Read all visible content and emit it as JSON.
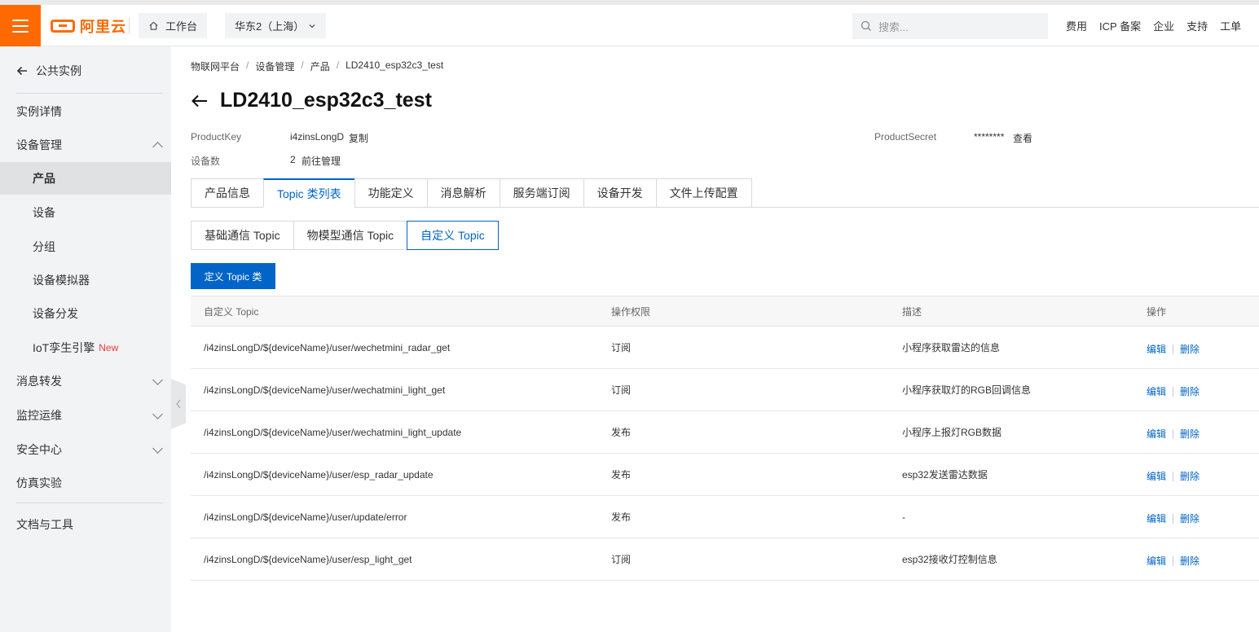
{
  "topbar": {
    "logo_text": "阿里云",
    "workbench": "工作台",
    "region": "华东2（上海）",
    "search_placeholder": "搜索...",
    "links": [
      "费用",
      "ICP 备案",
      "企业",
      "支持",
      "工单"
    ]
  },
  "sidebar": {
    "back": "公共实例",
    "items": {
      "instance_detail": "实例详情",
      "device_mgmt": "设备管理",
      "product": "产品",
      "device": "设备",
      "group": "分组",
      "simulator": "设备模拟器",
      "distribution": "设备分发",
      "twin": "IoT孪生引擎",
      "twin_tag": "New",
      "message": "消息转发",
      "monitor": "监控运维",
      "security": "安全中心",
      "simulation": "仿真实验",
      "docs": "文档与工具"
    }
  },
  "breadcrumb": [
    "物联网平台",
    "设备管理",
    "产品",
    "LD2410_esp32c3_test"
  ],
  "page": {
    "title": "LD2410_esp32c3_test",
    "product_key_label": "ProductKey",
    "product_key": "i4zinsLongD",
    "copy": "复制",
    "product_secret_label": "ProductSecret",
    "product_secret": "********",
    "view": "查看",
    "device_count_label": "设备数",
    "device_count": "2",
    "go_manage": "前往管理"
  },
  "tabs": [
    "产品信息",
    "Topic 类列表",
    "功能定义",
    "消息解析",
    "服务端订阅",
    "设备开发",
    "文件上传配置"
  ],
  "subtabs": [
    "基础通信 Topic",
    "物模型通信 Topic",
    "自定义 Topic"
  ],
  "define_button": "定义 Topic 类",
  "table": {
    "headers": [
      "自定义 Topic",
      "操作权限",
      "描述",
      "操作"
    ],
    "rows": [
      {
        "topic": "/i4zinsLongD/${deviceName}/user/wechetmini_radar_get",
        "perm": "订阅",
        "desc": "小程序获取雷达的信息"
      },
      {
        "topic": "/i4zinsLongD/${deviceName}/user/wechatmini_light_get",
        "perm": "订阅",
        "desc": "小程序获取灯的RGB回调信息"
      },
      {
        "topic": "/i4zinsLongD/${deviceName}/user/wechatmini_light_update",
        "perm": "发布",
        "desc": "小程序上报灯RGB数据"
      },
      {
        "topic": "/i4zinsLongD/${deviceName}/user/esp_radar_update",
        "perm": "发布",
        "desc": "esp32发送雷达数据"
      },
      {
        "topic": "/i4zinsLongD/${deviceName}/user/update/error",
        "perm": "发布",
        "desc": "-"
      },
      {
        "topic": "/i4zinsLongD/${deviceName}/user/esp_light_get",
        "perm": "订阅",
        "desc": "esp32接收灯控制信息"
      }
    ],
    "edit": "编辑",
    "delete": "删除"
  },
  "colors": {
    "brand": "#ff6a00",
    "primary": "#0064c8",
    "new_tag": "#e73b3b"
  }
}
